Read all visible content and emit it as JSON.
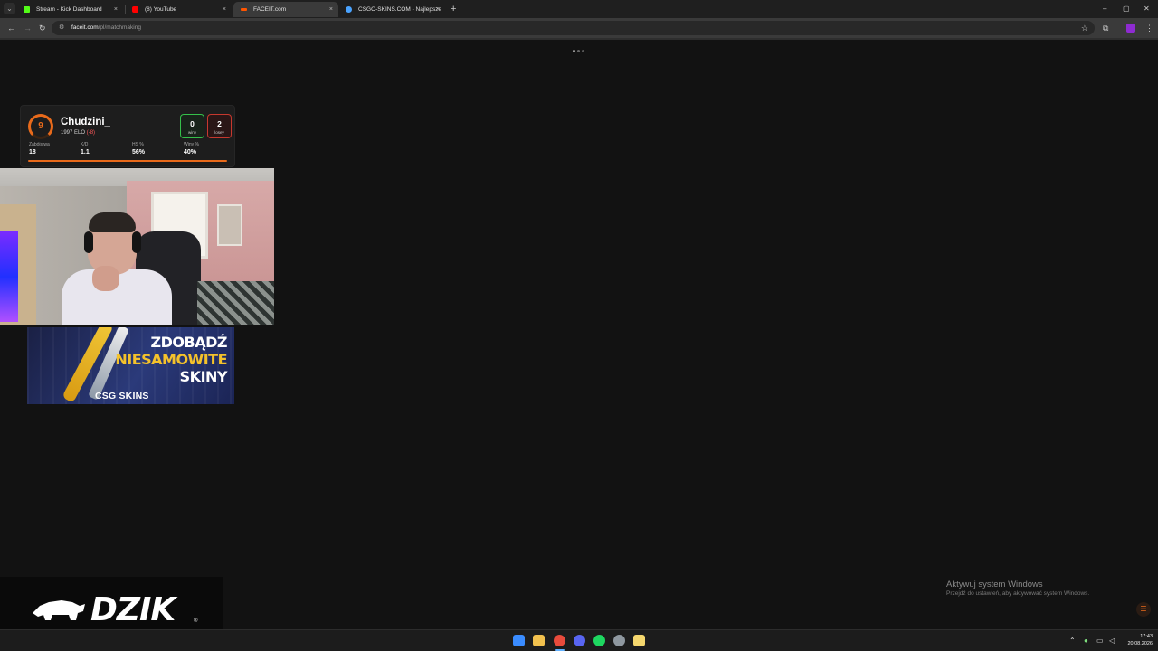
{
  "browser": {
    "tabs": [
      {
        "label": "Stream - Kick Dashboard",
        "favicon_color": "#53fc18",
        "active": false
      },
      {
        "label": "(8) YouTube",
        "favicon_color": "#ff0000",
        "active": false
      },
      {
        "label": "FACEIT.com",
        "favicon_color": "#ff5500",
        "active": true
      },
      {
        "label": "CSGO-SKINS.COM - Najlepsze",
        "favicon_color": "#4aa3ff",
        "active": false
      }
    ],
    "tab_close_glyph": "×",
    "new_tab_glyph": "+",
    "url_host": "faceit.com",
    "url_path": "/pl/matchmaking",
    "window_controls": [
      "–",
      "▢",
      "✕"
    ]
  },
  "faceit_overlay": {
    "level": "9",
    "nickname": "Chudzini_",
    "elo_text": "1997 ELO",
    "elo_change": "(-8)",
    "wins_value": "0",
    "wins_label": "winy",
    "losses_value": "2",
    "losses_label": "losey",
    "stats": [
      {
        "label": "Zabójstwa",
        "value": "18"
      },
      {
        "label": "K/D",
        "value": "1.1"
      },
      {
        "label": "HS %",
        "value": "56%"
      },
      {
        "label": "Winy %",
        "value": "40%"
      }
    ],
    "accent_color": "#e86a1b"
  },
  "ad": {
    "line1": "ZDOBĄDŹ",
    "line2": "NIESAMOWITE",
    "line3": "SKINY",
    "brand": "CSG SKINS"
  },
  "logo": {
    "text": "DZIK",
    "reg": "®"
  },
  "watermark": {
    "title": "Aktywuj system Windows",
    "subtitle": "Przejdź do ustawień, aby aktywować system Windows."
  },
  "taskbar": {
    "apps": [
      {
        "name": "start",
        "color": "#3a8cff"
      },
      {
        "name": "file-explorer",
        "color": "#f2c14e"
      },
      {
        "name": "chrome",
        "color": "#e84b3c"
      },
      {
        "name": "discord",
        "color": "#5865f2"
      },
      {
        "name": "spotify",
        "color": "#1ed760"
      },
      {
        "name": "steam",
        "color": "#8f98a0"
      },
      {
        "name": "notes",
        "color": "#f5d76e"
      }
    ],
    "time": "17:43",
    "date": "20.08.2026"
  }
}
